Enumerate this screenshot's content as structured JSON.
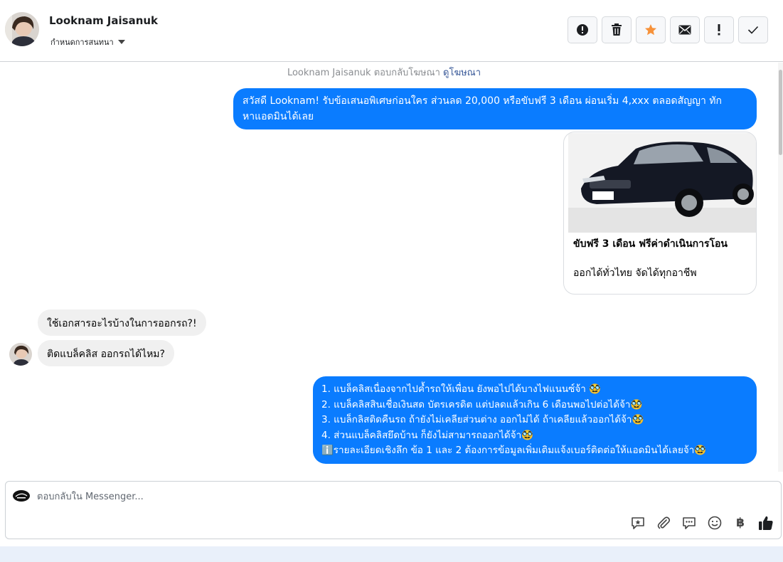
{
  "header": {
    "contact_name": "Looknam Jaisanuk",
    "assign_label": "กำหนดการสนทนา",
    "actions": [
      {
        "icon": "alert-circle-icon",
        "glyph": "!"
      },
      {
        "icon": "trash-icon"
      },
      {
        "icon": "star-icon",
        "color": "#f7923a"
      },
      {
        "icon": "envelope-icon"
      },
      {
        "icon": "exclamation-icon",
        "glyph": "!"
      },
      {
        "icon": "checkmark-icon",
        "glyph": "✓"
      }
    ]
  },
  "conversation": {
    "ad_note_text": "Looknam Jaisanuk ตอบกลับโฆษณา",
    "ad_note_link": "ดูโฆษณา",
    "messages": [
      {
        "direction": "out",
        "text_line1": "สวัสดี Looknam! รับข้อเสนอพิเศษก่อนใคร ส่วนลด 20,000 หรือขับฟรี 3 เดือน ผ่อนเริ่ม 4,xxx ตลอดสัญญา ทัก",
        "text_line2": "หาแอดมินได้เลย"
      },
      {
        "direction": "out",
        "type": "card",
        "title": "ขับฟรี 3 เดือน ฟรีค่าดำเนินการโอน",
        "subtitle": "ออกได้ทั่วไทย จัดได้ทุกอาชีพ"
      },
      {
        "direction": "in",
        "text": "ใช้เอกสารอะไรบ้างในการออกรถ?!"
      },
      {
        "direction": "in",
        "text": "ติดแบล็คลิส ออกรถได้ไหม?"
      },
      {
        "direction": "out",
        "lines": [
          "1. แบล็คลิสเนื่องจากไปค้ำรถให้เพื่อน ยังพอไปได้บางไฟแนนซ์จ้า 🥸",
          "2. แบล็คลิสสินเชื่อเงินสด บัตรเครดิต แต่ปลดแล้วเกิน 6 เดือนพอไปต่อได้จ้า🥸",
          "3. แบล็กลิสติดคืนรถ ถ้ายังไม่เคลียส่วนต่าง ออกไม่ได้ ถ้าเคลียแล้วออกได้จ้า🥸",
          "4. ส่วนแบล็คลิสยึดบ้าน ก็ยังไม่สามารถออกได้จ้า🥸",
          "ℹ️รายละเอียดเชิงลึก ข้อ 1 และ 2 ต้องการข้อมูลเพิ่มเติมแจ้งเบอร์ติดต่อให้แอดมินได้เลยจ้า🥸"
        ]
      }
    ]
  },
  "composer": {
    "placeholder": "ตอบกลับใน Messenger...",
    "tools": [
      "saved-reply-icon",
      "paperclip-icon",
      "chat-dots-icon",
      "smiley-icon",
      "baht-icon",
      "thumbs-up-icon"
    ],
    "baht_glyph": "฿"
  },
  "colors": {
    "outgoing_bubble": "#0a7cff",
    "incoming_bubble": "#f0f0f0",
    "star": "#f7923a"
  }
}
